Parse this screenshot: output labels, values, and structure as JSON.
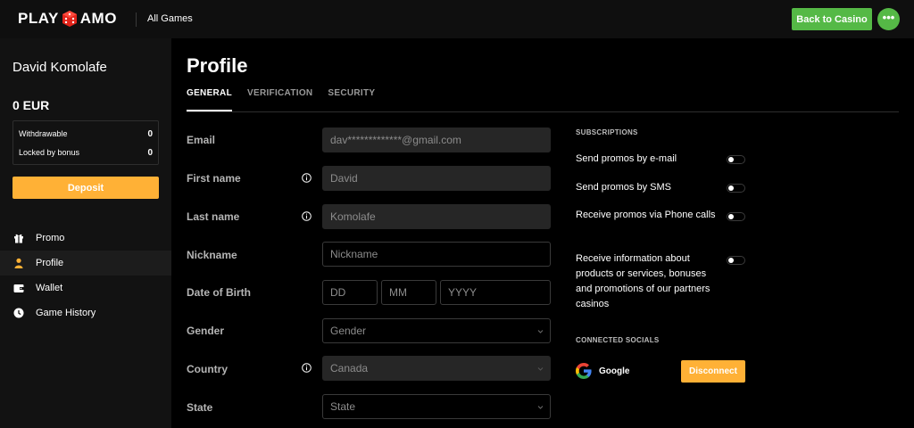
{
  "header": {
    "logo_left": "PLAY",
    "logo_right": "AMO",
    "all_games": "All Games",
    "back_button": "Back to Casino",
    "menu_dots": "•••"
  },
  "sidebar": {
    "user_name": "David Komolafe",
    "balance": "0  EUR",
    "withdrawable_label": "Withdrawable",
    "withdrawable_value": "0",
    "locked_label": "Locked by bonus",
    "locked_value": "0",
    "deposit_button": "Deposit",
    "nav": [
      {
        "label": "Promo",
        "icon": "gift-icon"
      },
      {
        "label": "Profile",
        "icon": "user-icon",
        "active": true
      },
      {
        "label": "Wallet",
        "icon": "wallet-icon"
      },
      {
        "label": "Game History",
        "icon": "clock-icon"
      }
    ]
  },
  "main": {
    "title": "Profile",
    "tabs": [
      {
        "label": "GENERAL",
        "active": true
      },
      {
        "label": "VERIFICATION"
      },
      {
        "label": "SECURITY"
      }
    ],
    "form": {
      "email_label": "Email",
      "email_value": "dav*************@gmail.com",
      "first_name_label": "First name",
      "first_name_value": "David",
      "last_name_label": "Last name",
      "last_name_value": "Komolafe",
      "nickname_label": "Nickname",
      "nickname_placeholder": "Nickname",
      "dob_label": "Date of Birth",
      "dob_day_placeholder": "DD",
      "dob_month_placeholder": "MM",
      "dob_year_placeholder": "YYYY",
      "gender_label": "Gender",
      "gender_value": "Gender",
      "country_label": "Country",
      "country_value": "Canada",
      "state_label": "State",
      "state_value": "State"
    },
    "subscriptions": {
      "heading": "SUBSCRIPTIONS",
      "items": [
        "Send promos by e-mail",
        "Send promos by SMS",
        "Receive promos via Phone calls",
        "Receive information about products or services, bonuses and promotions of our partners casinos"
      ]
    },
    "socials": {
      "heading": "CONNECTED SOCIALS",
      "google_label": "Google",
      "disconnect_button": "Disconnect"
    }
  },
  "colors": {
    "green": "#55b946",
    "orange": "#ffb136",
    "logo_red": "#e2231a"
  }
}
